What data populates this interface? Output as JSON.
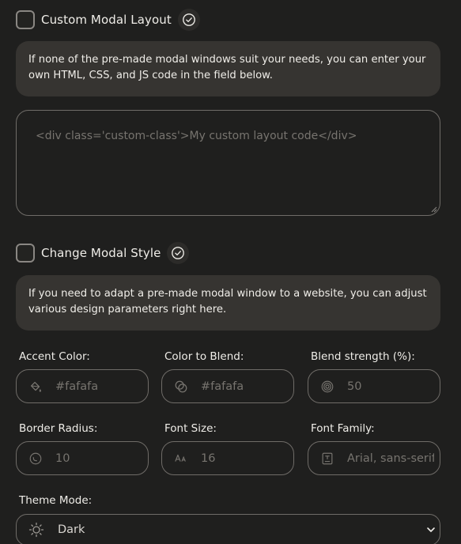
{
  "custom_layout": {
    "title": "Custom Modal Layout",
    "notice": "If none of the pre-made modal windows suit your needs, you can enter your own HTML, CSS, and JS code in the field below.",
    "code_placeholder": "<div class='custom-class'>My custom layout code</div>"
  },
  "modal_style": {
    "title": "Change Modal Style",
    "notice": "If you need to adapt a pre-made modal window to a website, you can adjust various design parameters right here."
  },
  "fields": {
    "accent_color": {
      "label": "Accent Color:",
      "placeholder": "#fafafa",
      "icon": "paint-bucket-icon"
    },
    "color_to_blend": {
      "label": "Color to Blend:",
      "placeholder": "#fafafa",
      "icon": "blend-circles-icon"
    },
    "blend_strength": {
      "label": "Blend strength (%):",
      "placeholder": "50",
      "icon": "spiral-icon"
    },
    "border_radius": {
      "label": "Border Radius:",
      "placeholder": "10",
      "icon": "radius-icon"
    },
    "font_size": {
      "label": "Font Size:",
      "placeholder": "16",
      "icon": "font-size-icon"
    },
    "font_family": {
      "label": "Font Family:",
      "placeholder": "Arial, sans-serif",
      "icon": "font-family-icon"
    }
  },
  "theme_mode": {
    "label": "Theme Mode:",
    "value": "Dark",
    "icon": "sun-moon-icon"
  },
  "colors": {
    "background": "#1f1f1e",
    "notice_bg": "#363431",
    "border": "#6f6c68",
    "text": "#efede8",
    "placeholder": "#77746f"
  }
}
